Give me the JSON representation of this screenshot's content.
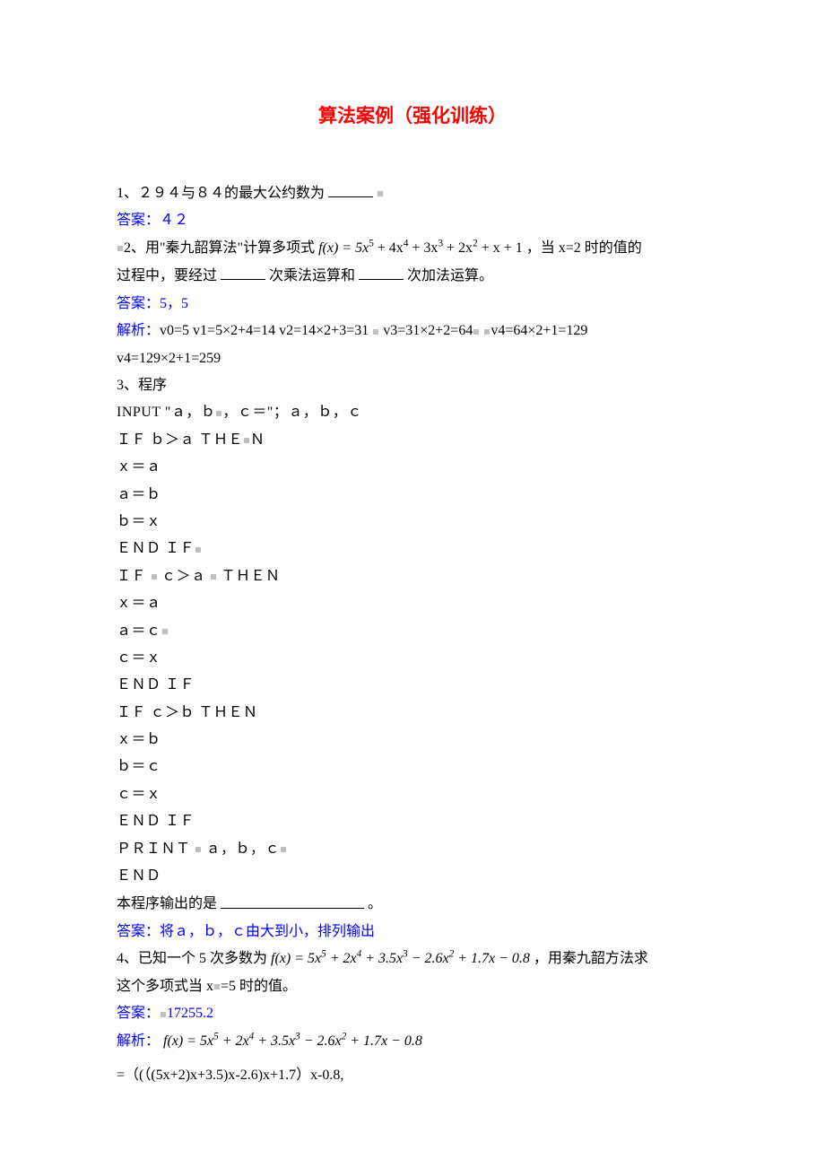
{
  "title": "算法案例（强化训练）",
  "q1": {
    "text_a": "1、２９４与８４的最大公约数为",
    "ans_label": "答案：",
    "ans_value": "４２"
  },
  "q2": {
    "text_a": "2、用\"秦九韶算法\"计算多项式 ",
    "formula": "f(x) = 5x",
    "formula_rest": " + 4x",
    "formula_3": " + 3x",
    "formula_2": " + 2x",
    "formula_tail": " + x + 1",
    "text_b": "，当 x=2 时的值的",
    "text_c": "过程中，要经过",
    "text_d": "次乘法运算和",
    "text_e": "次加法运算。",
    "ans_label": "答案：",
    "ans_value": "5，5",
    "sol_label": "解析：",
    "sol_a": "v0=5    v1=5×2+4=14    v2=14×2+3=31    ",
    "sol_b": "v3=31×2+2=64",
    "sol_c": "v4=64×2+1=129",
    "sol_d": "v4=129×2+1=259"
  },
  "q3": {
    "text_a": "3、程序",
    "code1": "    INPUT        \"ａ，ｂ",
    "code1b": "，ｃ＝\"；ａ，ｂ，ｃ",
    "code2": "ＩＦ      ｂ＞ａ        ＴＨＥ",
    "code2b": "Ｎ",
    "code3": "ｘ＝ａ",
    "code4": "ａ＝ｂ",
    "code5": "ｂ＝ｘ",
    "code6": "ＥＮＤ      ＩＦ",
    "code7": "ＩＦ    ",
    "code7b": "    ｃ＞ａ    ",
    "code7c": "    ＴＨＥＮ",
    "code8": "ｘ＝ａ",
    "code9": "ａ＝ｃ",
    "code10": "ｃ＝ｘ",
    "code11": "ＥＮＤ      ＩＦ",
    "code12": "ＩＦ      ｃ＞ｂ        ＴＨＥＮ",
    "code13": "ｘ＝ｂ",
    "code14": "ｂ＝ｃ",
    "code15": "ｃ＝ｘ",
    "code16": "ＥＮＤ    ＩＦ",
    "code17": "ＰＲＩＮＴ  ",
    "code17b": "      ａ，ｂ，ｃ",
    "code18": "ＥＮＤ",
    "text_b": "本程序输出的是",
    "text_c": "。",
    "ans_label": "答案：",
    "ans_value": "将ａ，ｂ，ｃ由大到小，排列输出"
  },
  "q4": {
    "text_a": "4、已知一个 5 次多数为 ",
    "formula_fx": "f(x) = 5x",
    "formula_p2": " + 2x",
    "formula_p3": " + 3.5x",
    "formula_m26": " − 2.6x",
    "formula_p17": " + 1.7x − 0.8",
    "text_b": "，用秦九韶方法求",
    "text_c": "这个多项式当 x",
    "text_d": "=5 时的值。",
    "ans_label": "答案：",
    "ans_value": "17255.2",
    "sol_label": "解析：",
    "sol_fx": " f(x) = 5x",
    "sol_line2": "=（(（(5x+2)x+3.5)x-2.6)x+1.7）x-0.8,"
  }
}
